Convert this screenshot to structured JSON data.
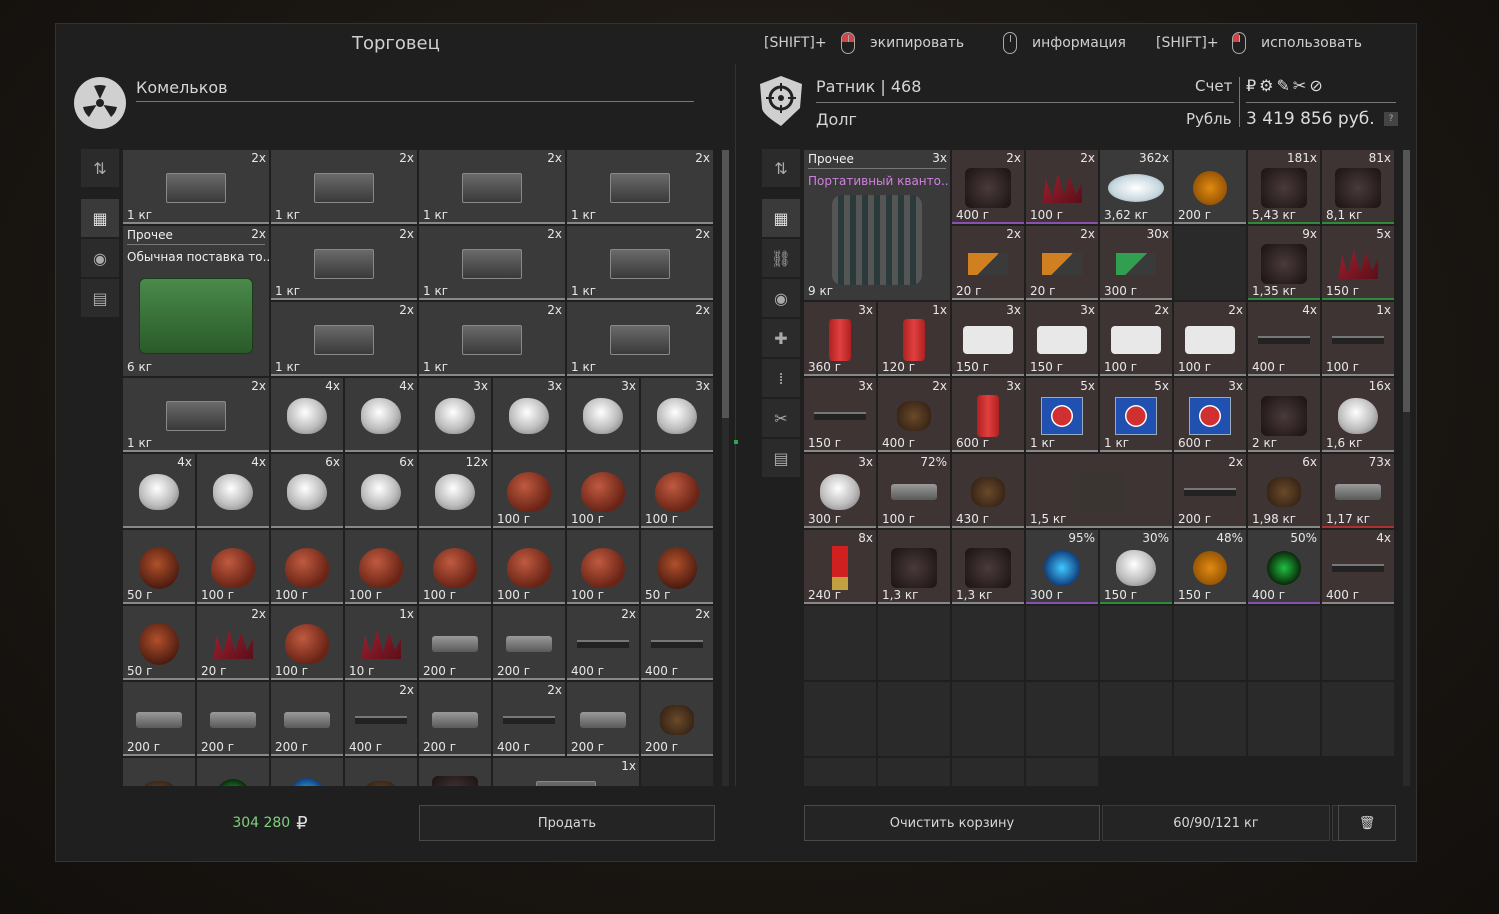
{
  "topbar": {
    "title": "Торговец",
    "hint1_key": "[SHIFT]+",
    "hint1_action": "экипировать",
    "hint2_action": "информация",
    "hint3_key": "[SHIFT]+",
    "hint3_action": "использовать"
  },
  "trader": {
    "name": "Комельков"
  },
  "player": {
    "rank": "Ратник | 468",
    "faction": "Долг",
    "account_label": "Счет",
    "currency_label": "Рубль",
    "money": "3 419 856 руб.",
    "currency_icons": "₽⚙✎✂⊘",
    "help": "?"
  },
  "left_grid": [
    {
      "q": "2x",
      "w": "1 кг",
      "t": "crate"
    },
    {
      "q": "2x",
      "w": "1 кг",
      "t": "crate"
    },
    {
      "q": "2x",
      "w": "1 кг",
      "t": "crate"
    },
    {
      "q": "2x",
      "w": "1 кг",
      "t": "crate"
    },
    {
      "q": "2x",
      "w": "1 кг",
      "t": "crate"
    },
    {
      "q": "2x",
      "w": "1 кг",
      "t": "crate"
    },
    {
      "q": "2x",
      "w": "1 кг",
      "t": "crate"
    },
    {
      "q": "2x",
      "w": "1 кг",
      "t": "crate"
    },
    {
      "q": "2x",
      "w": "1 кг",
      "t": "crate"
    },
    {
      "q": "2x",
      "w": "1 кг",
      "t": "crate"
    },
    {
      "q": "2x",
      "w": "1 кг",
      "t": "crate"
    },
    {
      "q": "4x",
      "w": "",
      "t": "blob"
    },
    {
      "q": "4x",
      "w": "",
      "t": "blob"
    },
    {
      "q": "3x",
      "w": "",
      "t": "blob"
    },
    {
      "q": "3x",
      "w": "",
      "t": "blob"
    },
    {
      "q": "3x",
      "w": "",
      "t": "blob"
    },
    {
      "q": "3x",
      "w": "",
      "t": "blob"
    },
    {
      "q": "4x",
      "w": "",
      "t": "blob"
    },
    {
      "q": "4x",
      "w": "",
      "t": "blob"
    },
    {
      "q": "6x",
      "w": "",
      "t": "blob"
    },
    {
      "q": "6x",
      "w": "",
      "t": "blob"
    },
    {
      "q": "12x",
      "w": "",
      "t": "blob"
    },
    {
      "q": "",
      "w": "100 г",
      "t": "heart"
    },
    {
      "q": "",
      "w": "100 г",
      "t": "heart"
    },
    {
      "q": "",
      "w": "100 г",
      "t": "heart"
    },
    {
      "q": "",
      "w": "50 г",
      "t": "organ"
    },
    {
      "q": "",
      "w": "100 г",
      "t": "heart"
    },
    {
      "q": "",
      "w": "100 г",
      "t": "heart"
    },
    {
      "q": "",
      "w": "100 г",
      "t": "heart"
    },
    {
      "q": "",
      "w": "100 г",
      "t": "heart"
    },
    {
      "q": "",
      "w": "100 г",
      "t": "heart"
    },
    {
      "q": "",
      "w": "100 г",
      "t": "heart"
    },
    {
      "q": "",
      "w": "50 г",
      "t": "organ"
    },
    {
      "q": "",
      "w": "50 г",
      "t": "organ"
    },
    {
      "q": "2x",
      "w": "20 г",
      "t": "spike"
    },
    {
      "q": "",
      "w": "100 г",
      "t": "heart"
    },
    {
      "q": "1x",
      "w": "10 г",
      "t": "spike"
    },
    {
      "q": "",
      "w": "200 г",
      "t": "tool"
    },
    {
      "q": "",
      "w": "200 г",
      "t": "tool"
    },
    {
      "q": "2x",
      "w": "400 г",
      "t": "knife"
    },
    {
      "q": "2x",
      "w": "400 г",
      "t": "knife"
    },
    {
      "q": "",
      "w": "200 г",
      "t": "tool"
    },
    {
      "q": "",
      "w": "200 г",
      "t": "tool"
    },
    {
      "q": "",
      "w": "200 г",
      "t": "tool"
    },
    {
      "q": "2x",
      "w": "400 г",
      "t": "knife"
    },
    {
      "q": "",
      "w": "200 г",
      "t": "tool"
    },
    {
      "q": "2x",
      "w": "400 г",
      "t": "knife"
    },
    {
      "q": "",
      "w": "200 г",
      "t": "tool"
    },
    {
      "q": "",
      "w": "200 г",
      "t": "misc"
    },
    {
      "q": "",
      "w": "",
      "t": "misc"
    },
    {
      "q": "",
      "w": "",
      "t": "spk2"
    },
    {
      "q": "",
      "w": "",
      "t": "spark"
    },
    {
      "q": "",
      "w": "",
      "t": "misc"
    },
    {
      "q": "",
      "w": "",
      "t": "dark"
    },
    {
      "q": "1x",
      "w": "",
      "t": "crate"
    }
  ],
  "left_big": {
    "name": "Прочее",
    "sub": "Обычная поставка то..",
    "q": "2x",
    "w": "6 кг"
  },
  "right_big": {
    "name": "Прочее",
    "sub": "Портативный кванто..",
    "q": "3x",
    "w": "9 кг"
  },
  "right_grid": [
    {
      "q": "2x",
      "w": "400 г",
      "t": "dark",
      "c": "r",
      "b": "pu"
    },
    {
      "q": "2x",
      "w": "100 г",
      "t": "spike",
      "c": "r",
      "b": "pu"
    },
    {
      "q": "362x",
      "w": "3,62 кг",
      "t": "sand",
      "c": "item",
      "b": ""
    },
    {
      "q": "",
      "w": "200 г",
      "t": "orange",
      "c": "item",
      "b": ""
    },
    {
      "q": "181x",
      "w": "5,43 кг",
      "t": "dark",
      "c": "r",
      "b": "gr"
    },
    {
      "q": "81x",
      "w": "8,1 кг",
      "t": "dark",
      "c": "r",
      "b": "gr"
    },
    {
      "q": "2x",
      "w": "20 г",
      "t": "flag",
      "c": "r",
      "b": ""
    },
    {
      "q": "2x",
      "w": "20 г",
      "t": "flag",
      "c": "r",
      "b": ""
    },
    {
      "q": "30x",
      "w": "300 г",
      "t": "flagg",
      "c": "r",
      "b": ""
    },
    {
      "q": "",
      "w": "",
      "t": "",
      "c": "",
      "b": ""
    },
    {
      "q": "9x",
      "w": "1,35 кг",
      "t": "dark",
      "c": "r",
      "b": "gr"
    },
    {
      "q": "5x",
      "w": "150 г",
      "t": "spike",
      "c": "r",
      "b": "gr"
    },
    {
      "q": "3x",
      "w": "360 г",
      "t": "can",
      "c": "r",
      "b": ""
    },
    {
      "q": "1x",
      "w": "120 г",
      "t": "can",
      "c": "r",
      "b": ""
    },
    {
      "q": "3x",
      "w": "150 г",
      "t": "pills",
      "c": "r",
      "b": ""
    },
    {
      "q": "3x",
      "w": "150 г",
      "t": "pills",
      "c": "r",
      "b": ""
    },
    {
      "q": "2x",
      "w": "100 г",
      "t": "pills",
      "c": "r",
      "b": ""
    },
    {
      "q": "2x",
      "w": "100 г",
      "t": "pills",
      "c": "r",
      "b": ""
    },
    {
      "q": "4x",
      "w": "400 г",
      "t": "knife",
      "c": "r",
      "b": ""
    },
    {
      "q": "1x",
      "w": "100 г",
      "t": "knife",
      "c": "r",
      "b": ""
    },
    {
      "q": "3x",
      "w": "150 г",
      "t": "knife",
      "c": "r",
      "b": ""
    },
    {
      "q": "2x",
      "w": "400 г",
      "t": "misc",
      "c": "r",
      "b": ""
    },
    {
      "q": "3x",
      "w": "600 г",
      "t": "can",
      "c": "r",
      "b": ""
    },
    {
      "q": "5x",
      "w": "1 кг",
      "t": "medkit",
      "c": "r",
      "b": ""
    },
    {
      "q": "5x",
      "w": "1 кг",
      "t": "medkit",
      "c": "r",
      "b": ""
    },
    {
      "q": "3x",
      "w": "600 г",
      "t": "medkit",
      "c": "r",
      "b": ""
    },
    {
      "q": "",
      "w": "2 кг",
      "t": "dark",
      "c": "r",
      "b": ""
    },
    {
      "q": "16x",
      "w": "1,6 кг",
      "t": "blob",
      "c": "r",
      "b": ""
    },
    {
      "q": "3x",
      "w": "300 г",
      "t": "blob",
      "c": "r",
      "b": ""
    },
    {
      "q": "72%",
      "w": "100 г",
      "t": "tool",
      "c": "r",
      "b": ""
    },
    {
      "q": "",
      "w": "430 г",
      "t": "misc",
      "c": "r",
      "b": ""
    },
    {
      "q": "",
      "w": "1,5 кг",
      "t": "bag",
      "c": "r",
      "b": ""
    },
    {
      "q": "2x",
      "w": "200 г",
      "t": "knife",
      "c": "r",
      "b": ""
    },
    {
      "q": "6x",
      "w": "1,98 кг",
      "t": "misc",
      "c": "r",
      "b": ""
    },
    {
      "q": "73x",
      "w": "1,17 кг",
      "t": "tool",
      "c": "r",
      "b": "re"
    },
    {
      "q": "8x",
      "w": "240 г",
      "t": "shell",
      "c": "r",
      "b": ""
    },
    {
      "q": "",
      "w": "1,3 кг",
      "t": "dark",
      "c": "r",
      "b": ""
    },
    {
      "q": "",
      "w": "1,3 кг",
      "t": "dark",
      "c": "r",
      "b": ""
    },
    {
      "q": "95%",
      "w": "300 г",
      "t": "spark",
      "c": "item",
      "b": "pu"
    },
    {
      "q": "30%",
      "w": "150 г",
      "t": "blob",
      "c": "item",
      "b": "gr"
    },
    {
      "q": "48%",
      "w": "150 г",
      "t": "orange",
      "c": "item",
      "b": ""
    },
    {
      "q": "50%",
      "w": "400 г",
      "t": "spk2",
      "c": "item",
      "b": "pu"
    },
    {
      "q": "4x",
      "w": "400 г",
      "t": "knife",
      "c": "r",
      "b": ""
    }
  ],
  "bottom": {
    "sum": "304 280",
    "rub": "₽",
    "sell": "Продать",
    "clear": "Очистить корзину",
    "weight": "60/90/121 кг"
  }
}
